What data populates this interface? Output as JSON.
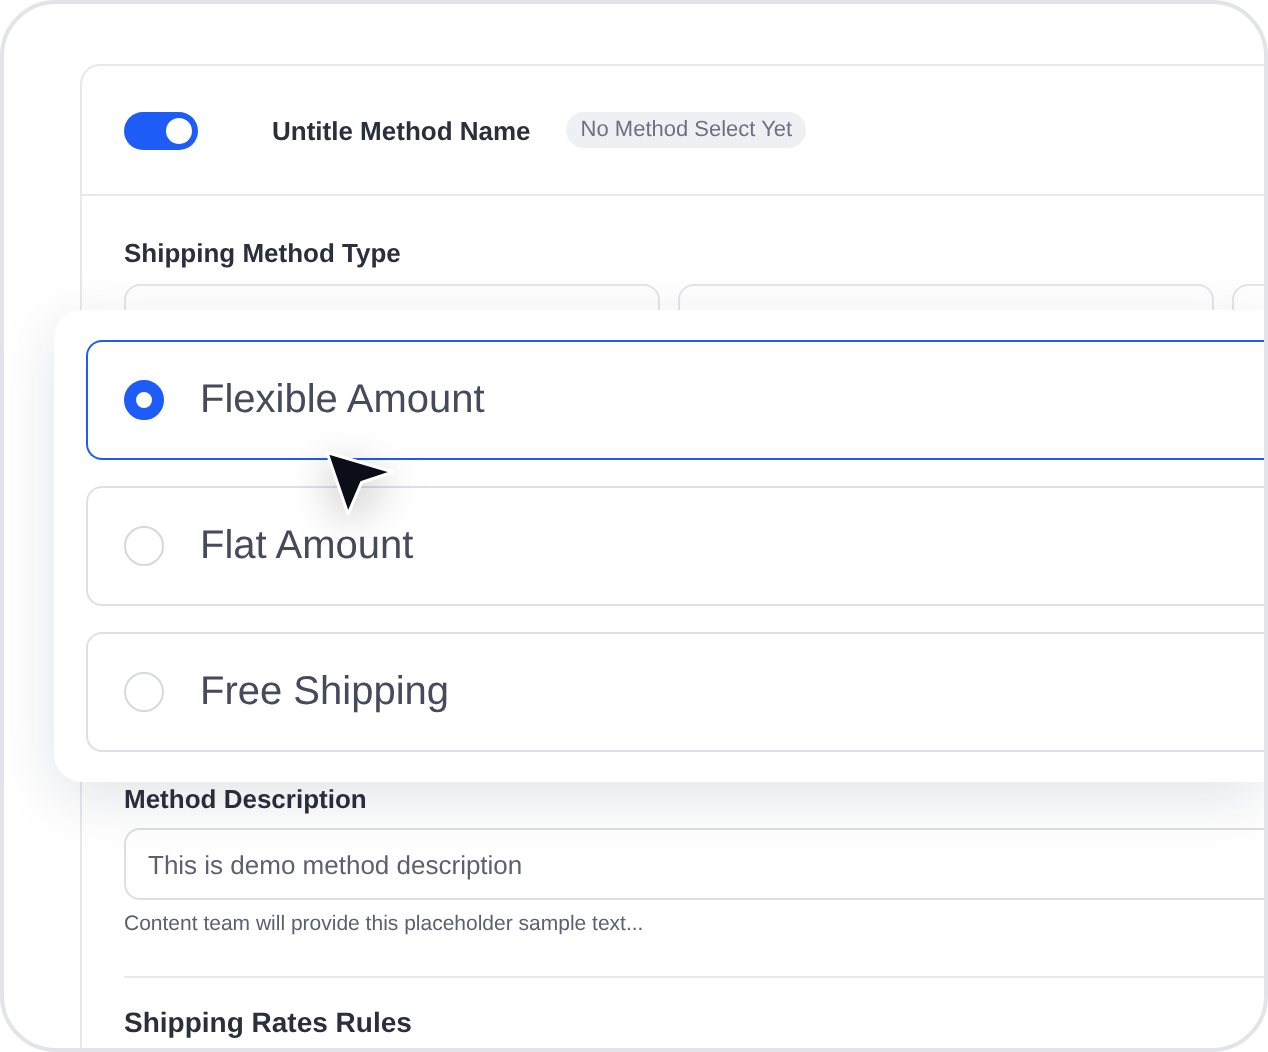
{
  "header": {
    "enabled": true,
    "title": "Untitle Method Name",
    "badge": "No Method Select Yet"
  },
  "shipping_method_type": {
    "label": "Shipping Method Type",
    "options": [
      {
        "label": "Flexible Amount",
        "selected": true
      },
      {
        "label": "Flat Amount",
        "selected": false
      },
      {
        "label": "Free Shipping",
        "selected": false
      }
    ]
  },
  "method_description": {
    "label": "Method Description",
    "value": "This is demo method description",
    "helper": "Content team will provide this placeholder sample text..."
  },
  "next_section": {
    "title": "Shipping Rates Rules"
  }
}
